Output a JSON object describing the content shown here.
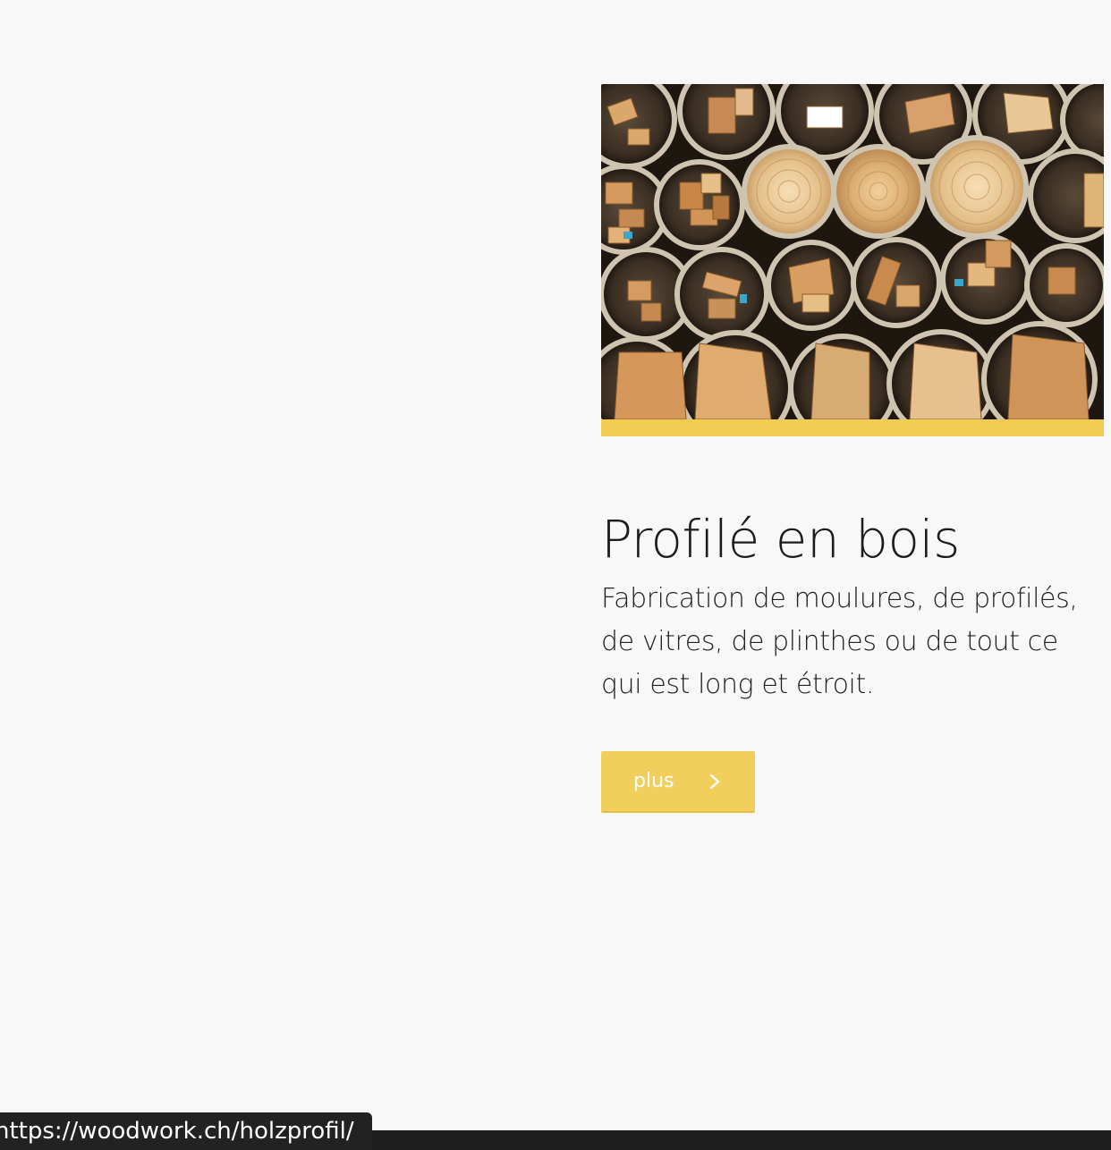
{
  "card": {
    "image_alt": "wood profiles in tubes",
    "title": "Profilé en bois",
    "description": "Fabrication de moulures, de profilés, de vitres, de plinthes ou de tout ce qui est long et étroit.",
    "button_label": "plus",
    "button_icon": "chevron-right-icon",
    "accent_color": "#f2cb51"
  },
  "status": {
    "link_url": "https://woodwork.ch/holzprofil/"
  }
}
